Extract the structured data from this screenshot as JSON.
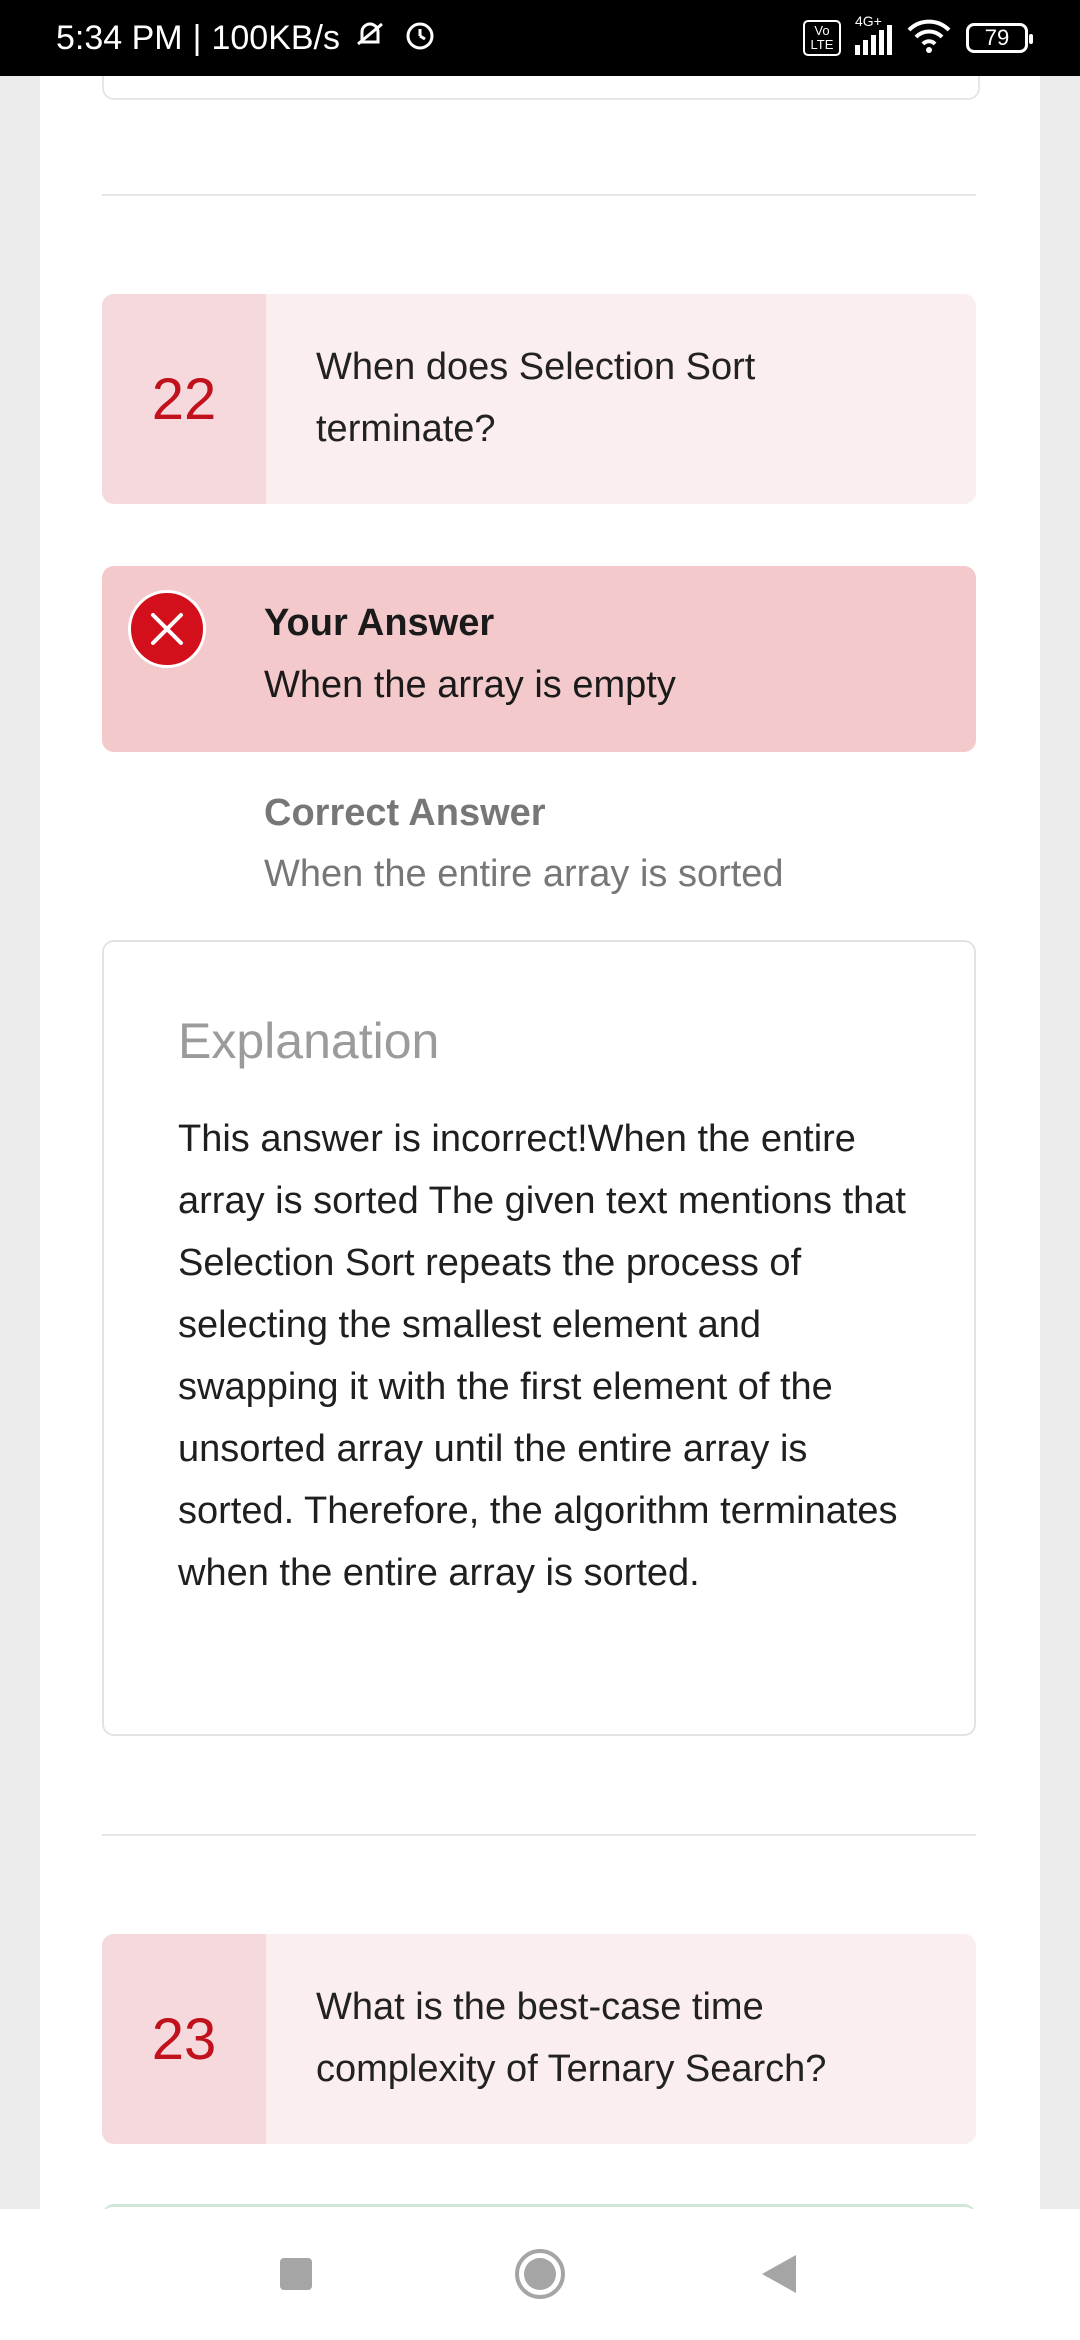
{
  "status_bar": {
    "time": "5:34 PM",
    "separator": "|",
    "speed": "100KB/s",
    "network": "4G+",
    "volte": "Vo LTE",
    "battery": "79"
  },
  "question_22": {
    "number": "22",
    "text": "When does Selection Sort terminate?",
    "your_answer_label": "Your Answer",
    "your_answer": "When the array is empty",
    "correct_answer_label": "Correct Answer",
    "correct_answer": "When the entire array is sorted",
    "explanation_heading": "Explanation",
    "explanation": "This answer is incorrect!When the entire array is sorted The given text mentions that Selection Sort repeats the process of selecting the smallest element and swapping it with the first element of the unsorted array until the entire array is sorted. Therefore, the algorithm terminates when the entire array is sorted."
  },
  "question_23": {
    "number": "23",
    "text": "What is the best-case time complexity of Ternary Search?"
  },
  "colors": {
    "accent_red": "#c0111c",
    "wrong_bg": "#f3c9cb",
    "question_bg": "#fbeeef"
  }
}
